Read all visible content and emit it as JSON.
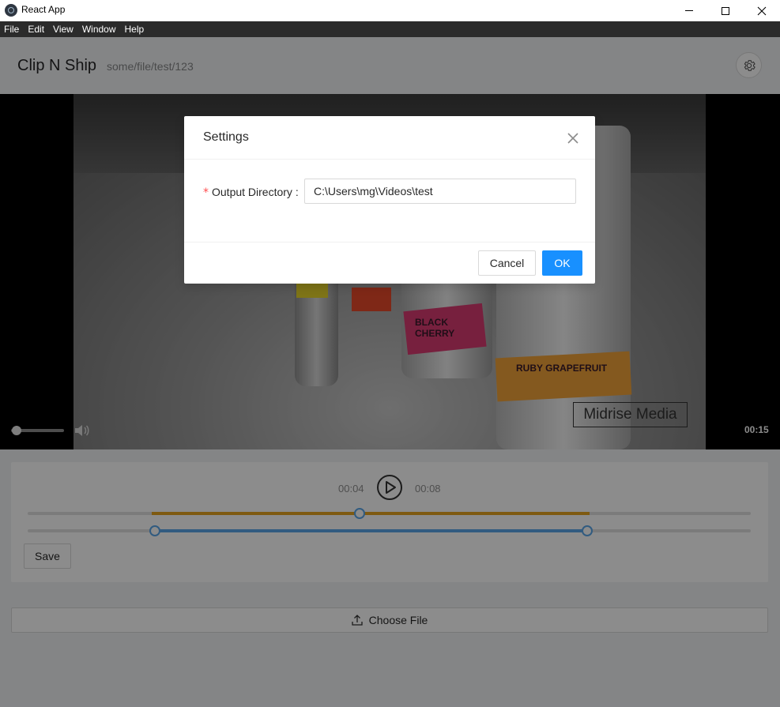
{
  "window": {
    "title": "React App"
  },
  "menu": {
    "items": [
      "File",
      "Edit",
      "View",
      "Window",
      "Help"
    ]
  },
  "header": {
    "app_name": "Clip N Ship",
    "file_path": "some/file/test/123",
    "settings_icon": "gear-icon"
  },
  "video": {
    "current_time": "00:15",
    "progress_fraction": 0.02,
    "volume_icon": "volume-icon",
    "can_labels": [
      "BLACK CHERRY",
      "RUBY GRAPEFRUIT"
    ],
    "watermark": "Midrise Media"
  },
  "editor": {
    "start_time": "00:04",
    "end_time": "00:08",
    "play_icon": "play-circle-icon",
    "save_label": "Save"
  },
  "upload": {
    "label": "Choose File",
    "icon": "upload-icon"
  },
  "modal": {
    "title": "Settings",
    "required_mark": "*",
    "output_label": "Output Directory",
    "output_value": "C:\\Users\\mg\\Videos\\test",
    "cancel_label": "Cancel",
    "ok_label": "OK",
    "close_icon": "close-icon"
  },
  "colors": {
    "primary": "#1890ff",
    "trim_track": "#5aa7ea",
    "seek_track": "#e6a420",
    "required": "#ff4d4f",
    "menubar": "#2b2b2b"
  }
}
